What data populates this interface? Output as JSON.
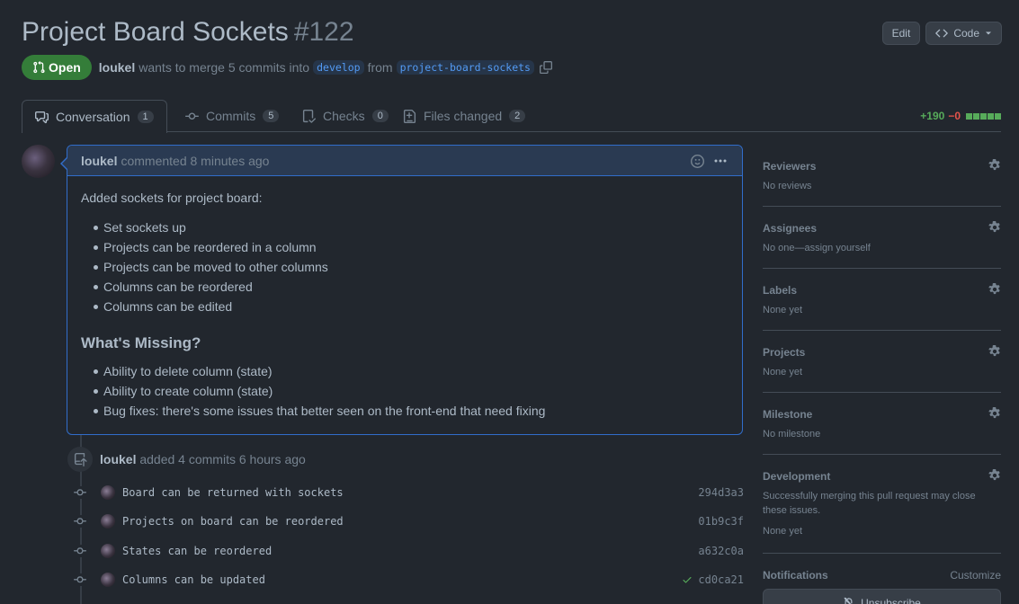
{
  "header": {
    "title": "Project Board Sockets",
    "number": "#122",
    "edit_label": "Edit",
    "code_label": "Code"
  },
  "meta": {
    "state": "Open",
    "author": "loukel",
    "merge_text": "wants to merge 5 commits into",
    "base_branch": "develop",
    "from_text": "from",
    "head_branch": "project-board-sockets"
  },
  "tabs": [
    {
      "label": "Conversation",
      "count": "1"
    },
    {
      "label": "Commits",
      "count": "5"
    },
    {
      "label": "Checks",
      "count": "0"
    },
    {
      "label": "Files changed",
      "count": "2"
    }
  ],
  "diffstat": {
    "additions": "+190",
    "deletions": "−0"
  },
  "comment": {
    "author": "loukel",
    "action": "commented 8 minutes ago",
    "intro": "Added sockets for project board:",
    "items": [
      "Set sockets up",
      "Projects can be reordered in a column",
      "Projects can be moved to other columns",
      "Columns can be reordered",
      "Columns can be edited"
    ],
    "heading": "What's Missing?",
    "missing": [
      "Ability to delete column (state)",
      "Ability to create column (state)",
      "Bug fixes: there's some issues that better seen on the front-end that need fixing"
    ]
  },
  "timeline": {
    "author": "loukel",
    "action": "added 4 commits 6 hours ago",
    "commits": [
      {
        "message": "Board can be returned with sockets",
        "sha": "294d3a3"
      },
      {
        "message": "Projects on board can be reordered",
        "sha": "01b9c3f"
      },
      {
        "message": "States can be reordered",
        "sha": "a632c0a"
      },
      {
        "message": "Columns can be updated",
        "sha": "cd0ca21"
      }
    ]
  },
  "sidebar": {
    "reviewers": {
      "title": "Reviewers",
      "value": "No reviews"
    },
    "assignees": {
      "title": "Assignees",
      "value": "No one—assign yourself"
    },
    "labels": {
      "title": "Labels",
      "value": "None yet"
    },
    "projects": {
      "title": "Projects",
      "value": "None yet"
    },
    "milestone": {
      "title": "Milestone",
      "value": "No milestone"
    },
    "development": {
      "title": "Development",
      "desc": "Successfully merging this pull request may close these issues.",
      "value": "None yet"
    },
    "notifications": {
      "title": "Notifications",
      "customize": "Customize",
      "unsubscribe": "Unsubscribe"
    }
  },
  "colors": {
    "accent": "#316dca",
    "success": "#347d39",
    "danger": "#e5534b",
    "bg": "#22272e"
  },
  "icons": [
    "git-pull-request-icon",
    "copy-icon",
    "code-icon",
    "comment-discussion-icon",
    "git-commit-icon",
    "checklist-icon",
    "file-diff-icon",
    "smiley-icon",
    "kebab-horizontal-icon",
    "repo-push-icon",
    "gear-icon",
    "check-icon",
    "bell-slash-icon"
  ]
}
